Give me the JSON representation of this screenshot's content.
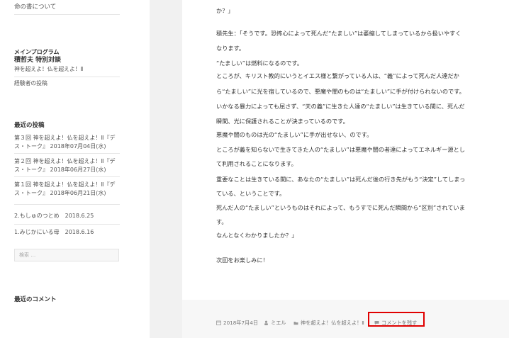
{
  "sidebar": {
    "top_link": "命の書について",
    "program_label": "メインプログラム",
    "program_title": "積哲夫 特別対談",
    "program_sub": "神を超えよ！仏を超えよ！Ⅱ",
    "experience_link": "経験者の投稿",
    "recent_posts_heading": "最近の投稿",
    "recent_posts": [
      {
        "line1": "第３回 神を超えよ！仏を超えよ！Ⅱ『デ",
        "line2": "ス・トーク』 2018年07月04日(水)"
      },
      {
        "line1": "第２回 神を超えよ！仏を超えよ！Ⅱ『デ",
        "line2": "ス・トーク』 2018年06月27日(水)"
      },
      {
        "line1": "第１回 神を超えよ！仏を超えよ！Ⅱ『デ",
        "line2": "ス・トーク』 2018年06月21日(水)"
      }
    ],
    "other_posts": [
      "2.もしゅのつとめ　2018.6.25",
      "1.みじかにいる母　2018.6.16"
    ],
    "search_placeholder": "検索 …",
    "recent_comments_heading": "最近のコメント"
  },
  "article": {
    "lines": [
      "か？」",
      "積先生：「そうです。恐怖心によって死んだ“たましい”は萎縮してしまっているから扱いやすく",
      "なります。",
      "“たましい”は燃料になるのです。",
      "ところが、キリスト教的にいうとイエス様と繋がっている人は、“義”によって死んだ人達だか",
      "ら“たましい”に光を宿しているので、悪魔や闇のものは“たましい”に手が付けられないのです。",
      "いかなる暴力によっても屈さず、“天の義”に生きた人達の“たましい”は生きている間に、死んだ",
      "瞬間、光に保護されることが決まっているのです。",
      "悪魔や闇のものは光の“たましい”に手が出せない、のです。",
      "ところが義を知らないで生きてきた人の“たましい”は悪魔や闇の者達によってエネルギー源とし",
      "て利用されることになります。",
      "重要なことは生きている間に、あなたの“たましい”は死んだ後の行き先がもう“決定”してしまっ",
      "ている、ということです。",
      "死んだ人の“たましい”というものはそれによって、もうすでに死んだ瞬間から“区別”されていま",
      "す。",
      "なんとなくわかりましたか？」",
      "次回をお楽しみに！"
    ]
  },
  "footer": {
    "date": "2018年7月4日",
    "author": "ミエル",
    "category": "神を超えよ！仏を超えよ！Ⅱ",
    "comment_link": "コメントを残す",
    "highlight_color": "#e00000"
  }
}
